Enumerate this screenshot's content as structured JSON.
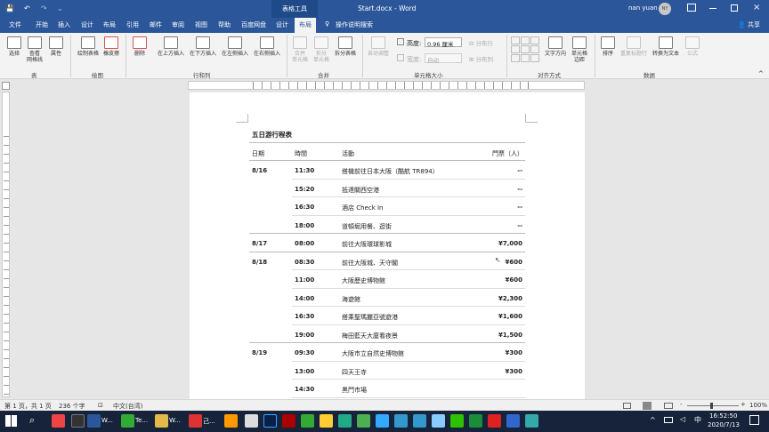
{
  "titlebar": {
    "tools_label": "表格工具",
    "doc_title": "Start.docx - Word",
    "user": "nan yuan",
    "avatar_initials": "NY"
  },
  "tabs": [
    "文件",
    "开始",
    "插入",
    "设计",
    "布局",
    "引用",
    "邮件",
    "审阅",
    "视图",
    "帮助",
    "百度网盘",
    "设计",
    "布局"
  ],
  "active_tab_index": 12,
  "tell_me": "操作说明搜索",
  "share": "共享",
  "ribbon": {
    "buttons": [
      "选择",
      "查看\n网格线",
      "属性",
      "绘制表格",
      "橡皮擦",
      "删除",
      "在上方插入",
      "在下方插入",
      "在左侧插入",
      "在右侧插入",
      "合并\n单元格",
      "拆分\n单元格",
      "拆分表格",
      "自动调整",
      "文字方向",
      "单元格\n边距",
      "排序",
      "重复标题行",
      "转换为文本",
      "公式"
    ],
    "height_label": "高度:",
    "height_value": "0.96 厘米",
    "width_label": "宽度:",
    "width_value": "自动",
    "distribute_rows": "分布行",
    "distribute_cols": "分布列",
    "groups": [
      "表",
      "绘图",
      "行和列",
      "合并",
      "单元格大小",
      "对齐方式",
      "数据"
    ]
  },
  "document": {
    "title": "五日游行程表",
    "headers": [
      "日期",
      "時間",
      "活動",
      "門票（人）"
    ],
    "rows": [
      {
        "date": "8/16",
        "time": "11:30",
        "activity": "搭機前往日本大阪（酷航 TR894）",
        "ticket": "--"
      },
      {
        "date": "",
        "time": "15:20",
        "activity": "抵達關西空港",
        "ticket": "--"
      },
      {
        "date": "",
        "time": "16:30",
        "activity": "酒店 Check In",
        "ticket": "--"
      },
      {
        "date": "",
        "time": "18:00",
        "activity": "道頓堀用餐、逛街",
        "ticket": "--"
      },
      {
        "date": "8/17",
        "time": "08:00",
        "activity": "前往大阪環球影城",
        "ticket": "¥7,000"
      },
      {
        "date": "8/18",
        "time": "08:30",
        "activity": "前往大阪城、天守閣",
        "ticket": "¥600"
      },
      {
        "date": "",
        "time": "11:00",
        "activity": "大阪歷史博物館",
        "ticket": "¥600"
      },
      {
        "date": "",
        "time": "14:00",
        "activity": "海遊館",
        "ticket": "¥2,300"
      },
      {
        "date": "",
        "time": "16:30",
        "activity": "搭乘聖瑪麗亞號遊港",
        "ticket": "¥1,600"
      },
      {
        "date": "",
        "time": "19:00",
        "activity": "梅田藍天大廈看夜景",
        "ticket": "¥1,500"
      },
      {
        "date": "8/19",
        "time": "09:30",
        "activity": "大阪市立自然史博物館",
        "ticket": "¥300"
      },
      {
        "date": "",
        "time": "13:00",
        "activity": "四天王寺",
        "ticket": "¥300"
      },
      {
        "date": "",
        "time": "14:30",
        "activity": "黑門市場",
        "ticket": ""
      }
    ]
  },
  "status": {
    "page": "第 1 页，共 1 页",
    "words": "236 个字",
    "lang": "中文(台湾)",
    "zoom": "100%"
  },
  "taskbar": {
    "time": "16:52:50",
    "date": "2020/7/13",
    "items": [
      "Te...",
      "W...",
      "W...",
      "己..."
    ],
    "ime": "中"
  },
  "colors": {
    "accent": "#2b579a",
    "taskbar": "#16233a"
  }
}
